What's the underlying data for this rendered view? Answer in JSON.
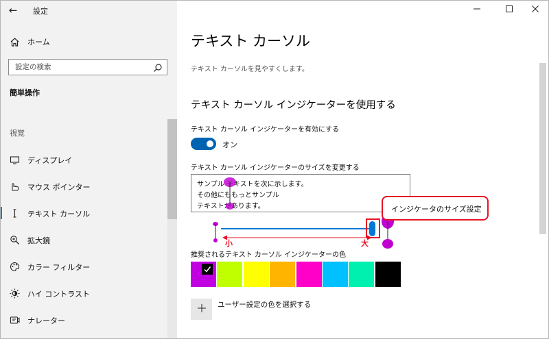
{
  "window": {
    "title": "設定",
    "controls": [
      "minimize-icon",
      "maximize-icon",
      "close-icon"
    ]
  },
  "sidebar": {
    "home_label": "ホーム",
    "search": {
      "placeholder": "設定の検索",
      "value": ""
    },
    "section_label": "簡単操作",
    "group_label": "視覚",
    "items": [
      {
        "label": "ディスプレイ",
        "icon": "display-icon",
        "active": false
      },
      {
        "label": "マウス ポインター",
        "icon": "mouse-pointer-icon",
        "active": false
      },
      {
        "label": "テキスト カーソル",
        "icon": "text-cursor-icon",
        "active": true
      },
      {
        "label": "拡大鏡",
        "icon": "magnifier-icon",
        "active": false
      },
      {
        "label": "カラー フィルター",
        "icon": "color-filter-icon",
        "active": false
      },
      {
        "label": "ハイ コントラスト",
        "icon": "high-contrast-icon",
        "active": false
      },
      {
        "label": "ナレーター",
        "icon": "narrator-icon",
        "active": false
      }
    ]
  },
  "main": {
    "title": "テキスト カーソル",
    "description": "テキスト カーソルを見やすくします。",
    "section_heading": "テキスト カーソル インジケーターを使用する",
    "toggle": {
      "label": "テキスト カーソル インジケーターを有効にする",
      "state_text": "オン",
      "on": true
    },
    "size": {
      "label": "テキスト カーソル インジケーターのサイズを変更する",
      "preview_lines": [
        "サンプル テキストを次に示します。",
        "その他にももっとサンプル",
        "テキストがあります。"
      ],
      "slider_level": 1.0,
      "min_label": "小",
      "max_label": "大"
    },
    "callout_text": "インジケータのサイズ設定",
    "colors": {
      "label": "推奨されるテキスト カーソル インジケーターの色",
      "swatches": [
        "#c000e0",
        "#bfff00",
        "#ffff00",
        "#ffb400",
        "#ff00c8",
        "#00c0ff",
        "#00f0b0",
        "#000000"
      ],
      "selected_index": 0
    },
    "custom_color_label": "ユーザー設定の色を選択する",
    "accent_color": "#0078d4",
    "indicator_color": "#c000d0",
    "callout_color": "#e81123"
  }
}
